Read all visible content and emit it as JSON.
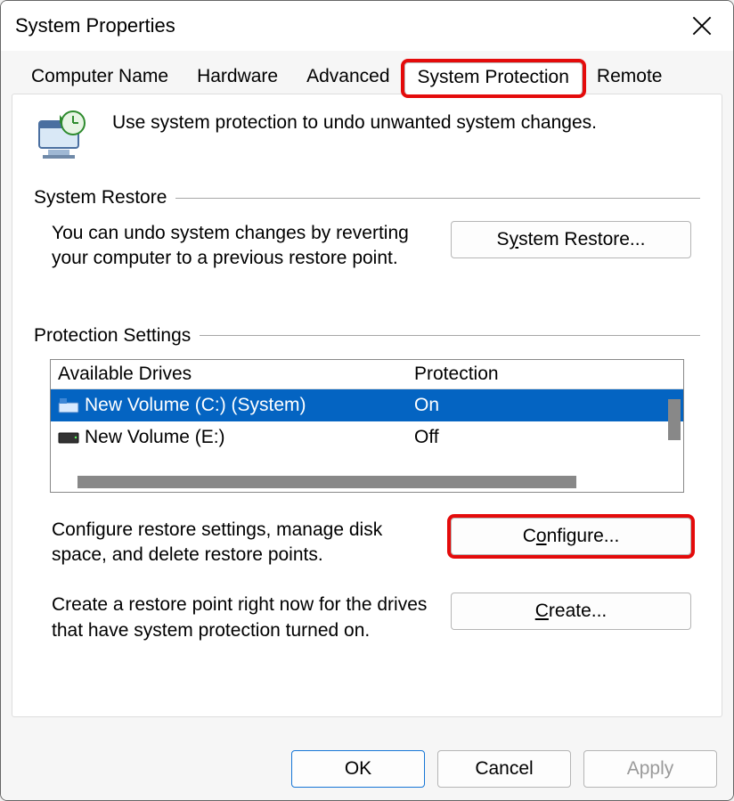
{
  "window": {
    "title": "System Properties"
  },
  "tabs": {
    "items": [
      {
        "label": "Computer Name"
      },
      {
        "label": "Hardware"
      },
      {
        "label": "Advanced"
      },
      {
        "label": "System Protection",
        "active": true,
        "highlighted": true
      },
      {
        "label": "Remote"
      }
    ]
  },
  "intro": {
    "text": "Use system protection to undo unwanted system changes."
  },
  "groups": {
    "restore": {
      "label": "System Restore",
      "description": "You can undo system changes by reverting your computer to a previous restore point.",
      "button_prefix": "S",
      "button_underline": "y",
      "button_suffix": "stem Restore..."
    },
    "protection": {
      "label": "Protection Settings",
      "headers": {
        "drives": "Available Drives",
        "protection": "Protection"
      },
      "drives": [
        {
          "name": "New Volume (C:) (System)",
          "protection": "On",
          "selected": true,
          "system": true
        },
        {
          "name": "New Volume (E:)",
          "protection": "Off",
          "selected": false,
          "system": false
        }
      ],
      "configure": {
        "description": "Configure restore settings, manage disk space, and delete restore points.",
        "button_prefix": "C",
        "button_underline": "o",
        "button_suffix": "nfigure..."
      },
      "create": {
        "description": "Create a restore point right now for the drives that have system protection turned on.",
        "button_prefix": "",
        "button_underline": "C",
        "button_suffix": "reate..."
      }
    }
  },
  "footer": {
    "ok": "OK",
    "cancel": "Cancel",
    "apply": "Apply"
  }
}
